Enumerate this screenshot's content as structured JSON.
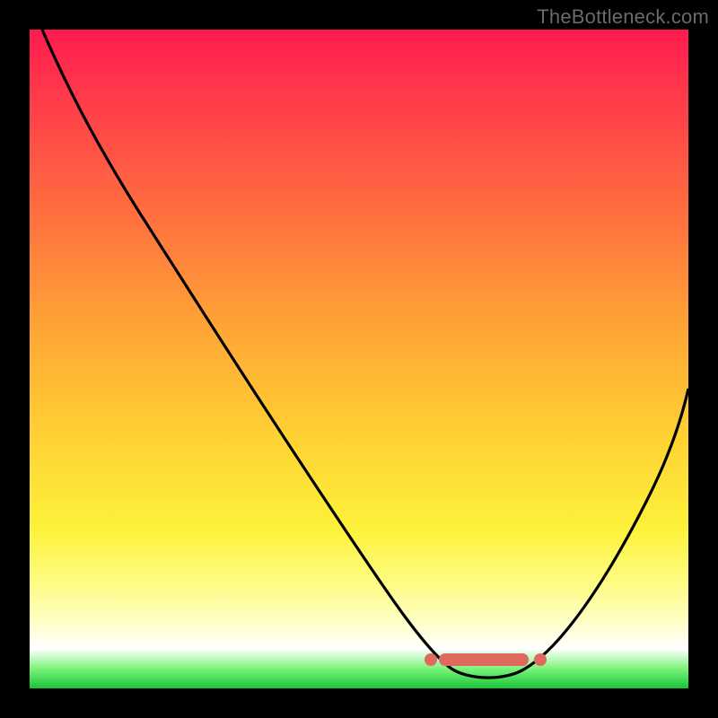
{
  "attribution": "TheBottleneck.com",
  "colors": {
    "frame": "#000000",
    "curve": "#000000",
    "band": "#e0695f",
    "gradient_stops": [
      "#ff1a4f",
      "#ff3a4a",
      "#ff6f3f",
      "#ffa436",
      "#ffd233",
      "#fdf23b",
      "#fdfc83",
      "#feffc8",
      "#ffffff",
      "#7cf37a",
      "#18c53a"
    ]
  },
  "chart_data": {
    "type": "line",
    "title": "",
    "xlabel": "",
    "ylabel": "",
    "xlim": [
      0,
      100
    ],
    "ylim": [
      0,
      100
    ],
    "x": [
      2,
      4,
      8,
      15,
      25,
      35,
      45,
      55,
      60,
      64,
      68,
      72,
      76,
      80,
      85,
      90,
      95,
      100
    ],
    "series": [
      {
        "name": "bottleneck-curve",
        "values": [
          100,
          98,
          92,
          82,
          67,
          52,
          37,
          21,
          13,
          7,
          3,
          1,
          3,
          9,
          18,
          29,
          41,
          54
        ]
      }
    ],
    "optimal_band": {
      "x_start": 62,
      "x_end": 78,
      "y": 4
    },
    "legend": false,
    "grid": false
  }
}
